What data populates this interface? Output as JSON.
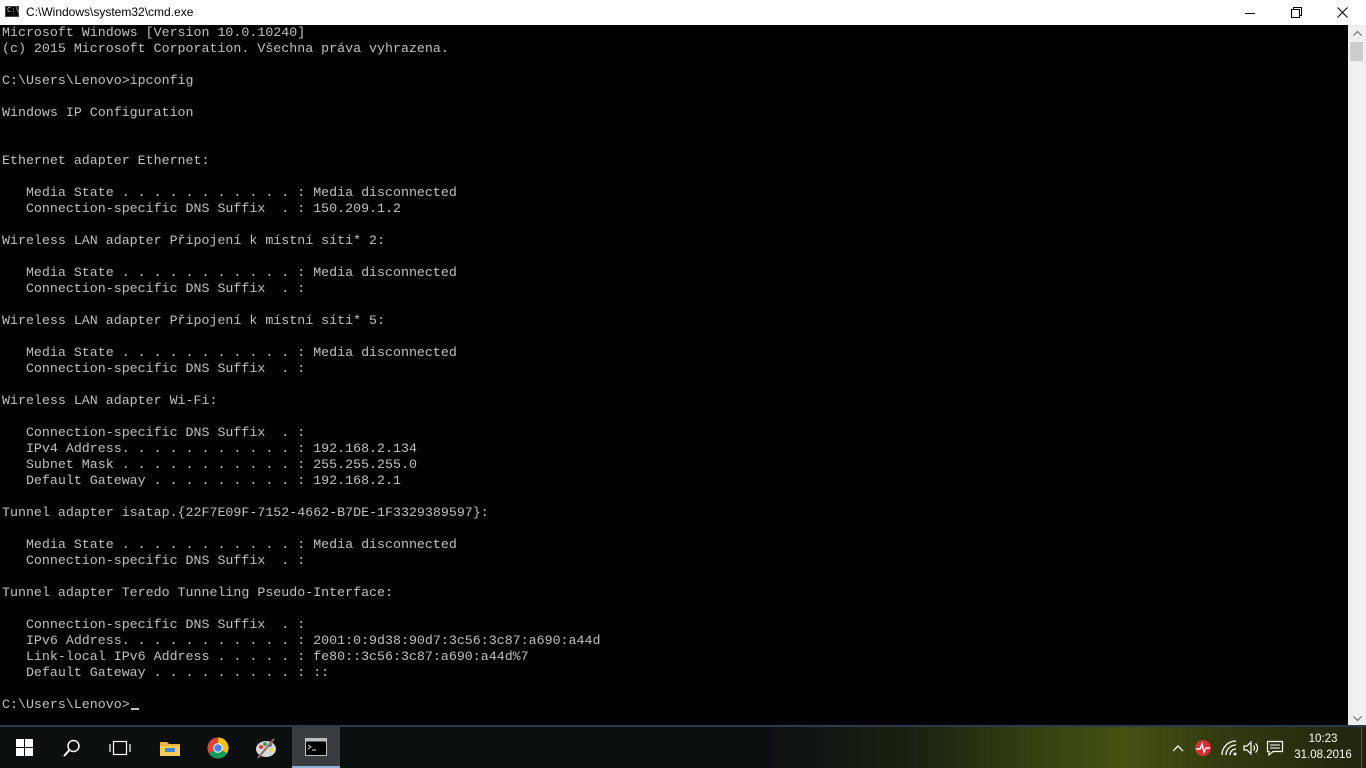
{
  "window": {
    "title": "C:\\Windows\\system32\\cmd.exe",
    "app_icon_text": "C:\\"
  },
  "console": {
    "lines": [
      "Microsoft Windows [Version 10.0.10240]",
      "(c) 2015 Microsoft Corporation. Všechna práva vyhrazena.",
      "",
      "C:\\Users\\Lenovo>ipconfig",
      "",
      "Windows IP Configuration",
      "",
      "",
      "Ethernet adapter Ethernet:",
      "",
      "   Media State . . . . . . . . . . . : Media disconnected",
      "   Connection-specific DNS Suffix  . : 150.209.1.2",
      "",
      "Wireless LAN adapter Připojení k místní síti* 2:",
      "",
      "   Media State . . . . . . . . . . . : Media disconnected",
      "   Connection-specific DNS Suffix  . :",
      "",
      "Wireless LAN adapter Připojení k místní síti* 5:",
      "",
      "   Media State . . . . . . . . . . . : Media disconnected",
      "   Connection-specific DNS Suffix  . :",
      "",
      "Wireless LAN adapter Wi-Fi:",
      "",
      "   Connection-specific DNS Suffix  . :",
      "   IPv4 Address. . . . . . . . . . . : 192.168.2.134",
      "   Subnet Mask . . . . . . . . . . . : 255.255.255.0",
      "   Default Gateway . . . . . . . . . : 192.168.2.1",
      "",
      "Tunnel adapter isatap.{22F7E09F-7152-4662-B7DE-1F3329389597}:",
      "",
      "   Media State . . . . . . . . . . . : Media disconnected",
      "   Connection-specific DNS Suffix  . :",
      "",
      "Tunnel adapter Teredo Tunneling Pseudo-Interface:",
      "",
      "   Connection-specific DNS Suffix  . :",
      "   IPv6 Address. . . . . . . . . . . : 2001:0:9d38:90d7:3c56:3c87:a690:a44d",
      "   Link-local IPv6 Address . . . . . : fe80::3c56:3c87:a690:a44d%7",
      "   Default Gateway . . . . . . . . . : ::",
      ""
    ],
    "prompt": "C:\\Users\\Lenovo>"
  },
  "colors": {
    "console_bg": "#000000",
    "console_fg": "#c0c0c0",
    "titlebar_bg": "#ffffff",
    "taskbar_bg": "#0c0f10",
    "taskbar_active": "#3a3d40"
  },
  "taskbar": {
    "apps": [
      {
        "name": "start",
        "icon": "windows-logo-icon"
      },
      {
        "name": "search",
        "icon": "search-icon"
      },
      {
        "name": "task-view",
        "icon": "task-view-icon"
      },
      {
        "name": "file-explorer",
        "icon": "folder-icon"
      },
      {
        "name": "chrome",
        "icon": "chrome-icon"
      },
      {
        "name": "paint",
        "icon": "paint-palette-icon"
      },
      {
        "name": "command-prompt",
        "icon": "cmd-icon",
        "active": true
      }
    ],
    "tray": {
      "icons": [
        "chevron-up-icon",
        "antivirus-icon",
        "wifi-icon",
        "volume-icon",
        "notification-icon"
      ],
      "time": "10:23",
      "date": "31.08.2016"
    }
  }
}
